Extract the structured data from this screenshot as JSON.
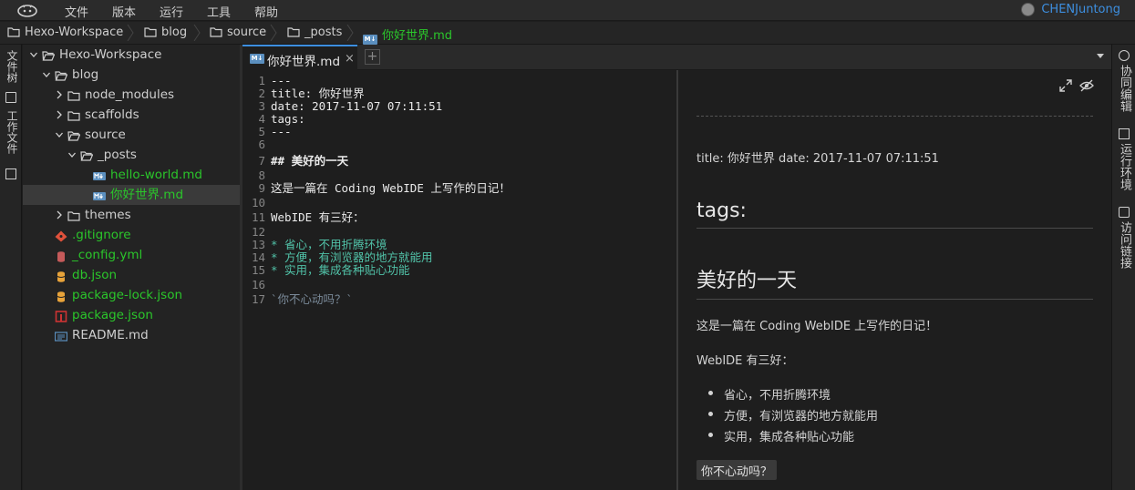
{
  "menu": {
    "items": [
      "文件",
      "版本",
      "运行",
      "工具",
      "帮助"
    ],
    "user": "CHENJuntong"
  },
  "breadcrumb": {
    "items": [
      "Hexo-Workspace",
      "blog",
      "source",
      "_posts",
      "你好世界.md"
    ]
  },
  "left_bar": {
    "tabs": [
      "文件树",
      "工作文件"
    ]
  },
  "tree": {
    "rows": [
      {
        "label": "Hexo-Workspace",
        "type": "folder-open",
        "icon": "folder-open-icon"
      },
      {
        "label": "blog",
        "type": "folder-open",
        "icon": "folder-open-icon"
      },
      {
        "label": "node_modules",
        "type": "folder",
        "icon": "folder-icon"
      },
      {
        "label": "scaffolds",
        "type": "folder",
        "icon": "folder-icon"
      },
      {
        "label": "source",
        "type": "folder-open",
        "icon": "folder-open-icon"
      },
      {
        "label": "_posts",
        "type": "folder-open",
        "icon": "folder-open-icon"
      },
      {
        "label": "hello-world.md",
        "type": "md",
        "icon": "markdown-icon"
      },
      {
        "label": "你好世界.md",
        "type": "md",
        "icon": "markdown-icon"
      },
      {
        "label": "themes",
        "type": "folder",
        "icon": "folder-icon"
      },
      {
        "label": ".gitignore",
        "type": "git",
        "icon": "git-icon"
      },
      {
        "label": "_config.yml",
        "type": "yml",
        "icon": "yaml-icon"
      },
      {
        "label": "db.json",
        "type": "json",
        "icon": "json-icon"
      },
      {
        "label": "package-lock.json",
        "type": "json",
        "icon": "json-icon"
      },
      {
        "label": "package.json",
        "type": "npm",
        "icon": "npm-icon"
      },
      {
        "label": "README.md",
        "type": "readme",
        "icon": "readme-icon"
      }
    ]
  },
  "tabs": {
    "active_title": "你好世界.md",
    "close_glyph": "×",
    "add_glyph": "+",
    "md_badge": "M↓"
  },
  "editor": {
    "lines": [
      {
        "n": "1",
        "text": "---"
      },
      {
        "n": "2",
        "text": "title: 你好世界"
      },
      {
        "n": "3",
        "text": "date: 2017-11-07 07:11:51"
      },
      {
        "n": "4",
        "text": "tags:"
      },
      {
        "n": "5",
        "text": "---"
      },
      {
        "n": "6",
        "text": ""
      },
      {
        "n": "7",
        "text": "## 美好的一天"
      },
      {
        "n": "8",
        "text": ""
      },
      {
        "n": "9",
        "text": "这是一篇在 Coding WebIDE 上写作的日记！"
      },
      {
        "n": "10",
        "text": ""
      },
      {
        "n": "11",
        "text": "WebIDE 有三好："
      },
      {
        "n": "12",
        "text": ""
      },
      {
        "n": "13",
        "text": "* 省心，不用折腾环境"
      },
      {
        "n": "14",
        "text": "* 方便，有浏览器的地方就能用"
      },
      {
        "n": "15",
        "text": "* 实用，集成各种贴心功能"
      },
      {
        "n": "16",
        "text": ""
      },
      {
        "n": "17",
        "text": "`你不心动吗？`"
      }
    ]
  },
  "preview": {
    "meta": "title: 你好世界 date: 2017-11-07 07:11:51",
    "h_tags": "tags:",
    "h_day": "美好的一天",
    "p1": "这是一篇在 Coding WebIDE 上写作的日记！",
    "p2": "WebIDE 有三好：",
    "list": [
      "省心，不用折腾环境",
      "方便，有浏览器的地方就能用",
      "实用，集成各种贴心功能"
    ],
    "code": "你不心动吗？"
  },
  "right_bar": {
    "tabs": [
      "协同编辑",
      "运行环境",
      "访问链接"
    ]
  },
  "colors": {
    "accent": "#3d8fe0",
    "git_modified": "#2bc62b"
  }
}
